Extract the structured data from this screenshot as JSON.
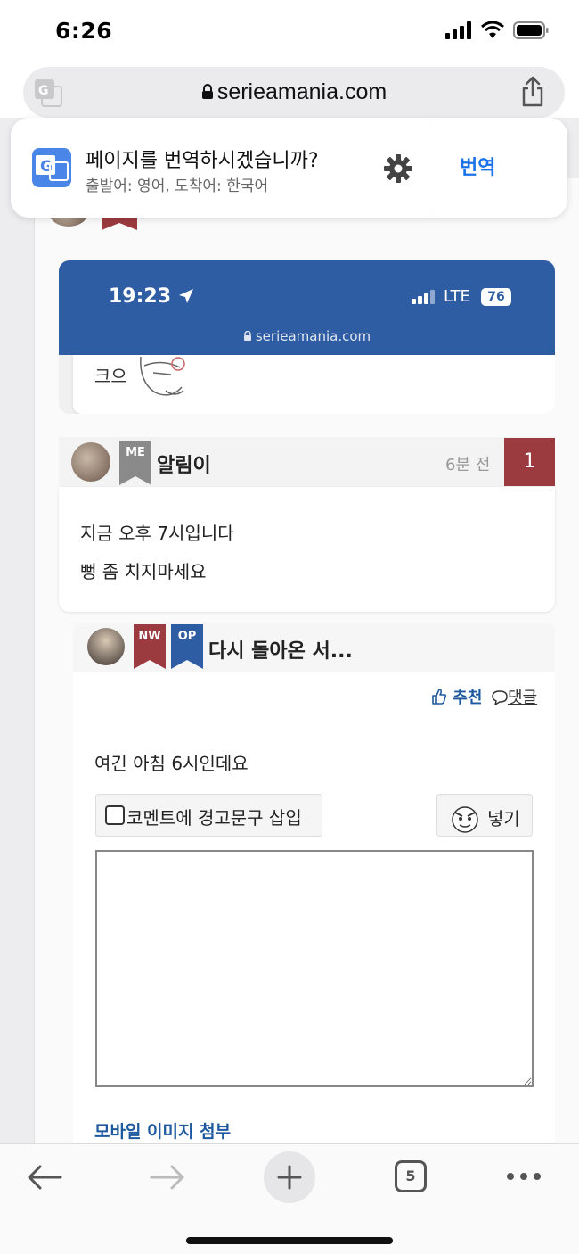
{
  "status_bar": {
    "time": "6:26"
  },
  "browser": {
    "url": "serieamania.com",
    "translate": {
      "title": "페이지를 번역하시겠습니까?",
      "subtitle": "출발어: 영어, 도착어: 한국어",
      "button": "번역"
    },
    "toolbar": {
      "tab_count": "5"
    }
  },
  "embedded_screenshot": {
    "time": "19:23",
    "network": "LTE",
    "battery": "76",
    "url": "serieamania.com",
    "text": "크으"
  },
  "comment_1": {
    "badge": "ME",
    "nickname": "알림이",
    "time_ago": "6분 전",
    "count": "1",
    "lines": [
      "지금 오후 7시입니다",
      "뻥 좀 치지마세요"
    ]
  },
  "comment_2": {
    "badges": [
      "NW",
      "OP"
    ],
    "nickname": "다시 돌아온 서...",
    "recommend": "추천",
    "reply": "댓글",
    "text": "여긴 아침 6시인데요",
    "warning_label": "코멘트에 경고문구 삽입",
    "insert_label": "넣기",
    "mobile_image": "모바일 이미지 첨부"
  },
  "colors": {
    "accent_blue": "#1a73e8",
    "header_blue": "#2f5da3",
    "ribbon_red": "#9b3a3f",
    "ribbon_gray": "#8a8a8a",
    "link_blue": "#1f5aa0"
  }
}
